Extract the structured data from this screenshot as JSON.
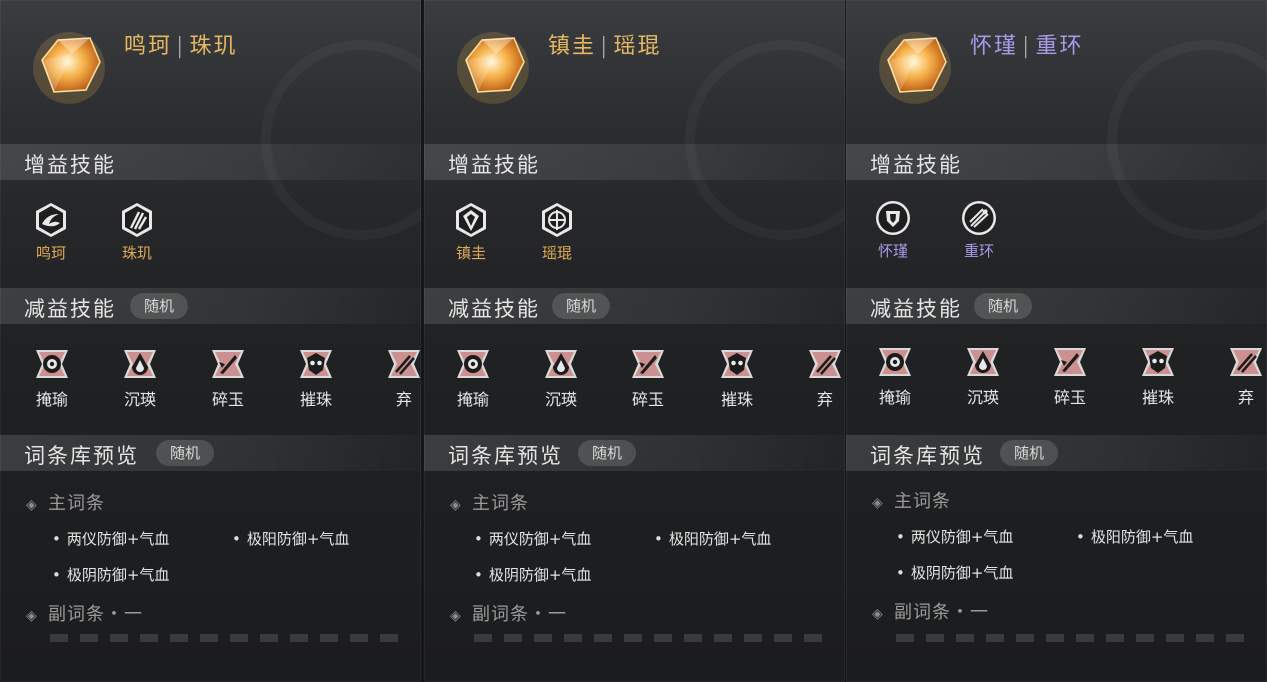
{
  "colors": {
    "gold": "#e0aa55",
    "purple": "#a99ae8",
    "text": "#e4e4e4",
    "muted": "#9a9a9a"
  },
  "panels": [
    {
      "theme": "gold",
      "title": {
        "name1": "鸣珂",
        "sep": "|",
        "name2": "珠玑"
      },
      "buff_title": "增益技能",
      "buffs": [
        {
          "label": "鸣珂",
          "icon": "wave-icon"
        },
        {
          "label": "珠玑",
          "icon": "claw-icon"
        }
      ],
      "debuff_title": "减益技能",
      "debuff_tag": "随机",
      "debuffs": [
        {
          "label": "掩瑜",
          "icon": "eye-icon"
        },
        {
          "label": "沉瑛",
          "icon": "drop-icon"
        },
        {
          "label": "碎玉",
          "icon": "shatter-icon"
        },
        {
          "label": "摧珠",
          "icon": "skull-icon"
        },
        {
          "label": "弃",
          "icon": "arrows-icon"
        }
      ],
      "lib_title": "词条库预览",
      "lib_tag": "随机",
      "main_title": "主词条",
      "main_entries": [
        "两仪防御+气血",
        "极阳防御+气血",
        "极阴防御+气血"
      ],
      "sub_title": "副词条・一"
    },
    {
      "theme": "gold",
      "title": {
        "name1": "镇圭",
        "sep": "|",
        "name2": "瑶琨"
      },
      "buff_title": "增益技能",
      "buffs": [
        {
          "label": "镇圭",
          "icon": "shield-icon"
        },
        {
          "label": "瑶琨",
          "icon": "lotus-icon"
        }
      ],
      "debuff_title": "减益技能",
      "debuff_tag": "随机",
      "debuffs": [
        {
          "label": "掩瑜",
          "icon": "eye-icon"
        },
        {
          "label": "沉瑛",
          "icon": "drop-icon"
        },
        {
          "label": "碎玉",
          "icon": "shatter-icon"
        },
        {
          "label": "摧珠",
          "icon": "skull-icon"
        },
        {
          "label": "弃",
          "icon": "arrows-icon"
        }
      ],
      "lib_title": "词条库预览",
      "lib_tag": "随机",
      "main_title": "主词条",
      "main_entries": [
        "两仪防御+气血",
        "极阳防御+气血",
        "极阴防御+气血"
      ],
      "sub_title": "副词条・一"
    },
    {
      "theme": "purple",
      "title": {
        "name1": "怀瑾",
        "sep": "|",
        "name2": "重环"
      },
      "buff_title": "增益技能",
      "buffs": [
        {
          "label": "怀瑾",
          "icon": "guard-icon"
        },
        {
          "label": "重环",
          "icon": "burst-icon"
        }
      ],
      "debuff_title": "减益技能",
      "debuff_tag": "随机",
      "debuffs": [
        {
          "label": "掩瑜",
          "icon": "eye-icon"
        },
        {
          "label": "沉瑛",
          "icon": "drop-icon"
        },
        {
          "label": "碎玉",
          "icon": "shatter-icon"
        },
        {
          "label": "摧珠",
          "icon": "skull-icon"
        },
        {
          "label": "弃",
          "icon": "arrows-icon"
        }
      ],
      "lib_title": "词条库预览",
      "lib_tag": "随机",
      "main_title": "主词条",
      "main_entries": [
        "两仪防御+气血",
        "极阳防御+气血",
        "极阴防御+气血"
      ],
      "sub_title": "副词条・一"
    }
  ]
}
